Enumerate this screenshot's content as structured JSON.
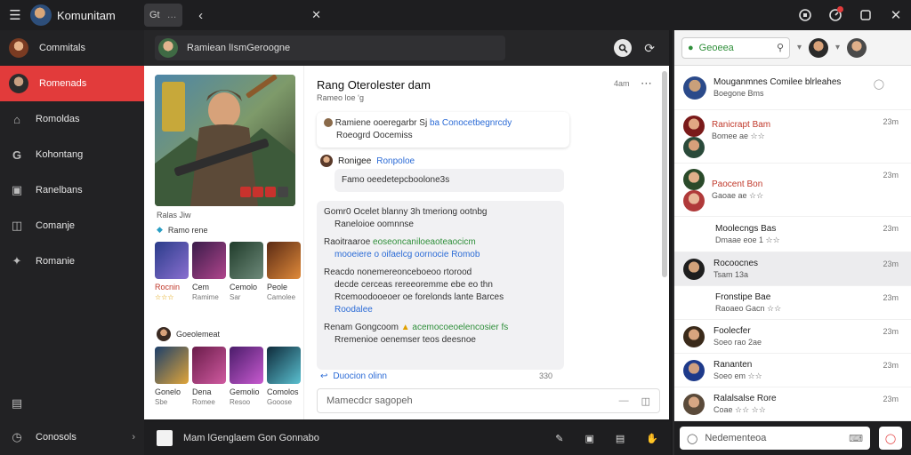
{
  "app": {
    "title": "Komunitam",
    "tab_label": "Gt",
    "tab_badge": "…"
  },
  "sidebar": {
    "items": [
      {
        "label": "Commitals",
        "icon": "avatar-icon"
      },
      {
        "label": "Romenads",
        "icon": "avatar-icon"
      },
      {
        "label": "Romoldas",
        "icon": "home-icon"
      },
      {
        "label": "Kohontang",
        "icon": "g-icon"
      },
      {
        "label": "Ranelbans",
        "icon": "panel-icon"
      },
      {
        "label": "Comanje",
        "icon": "window-icon"
      },
      {
        "label": "Romanie",
        "icon": "star-icon"
      }
    ],
    "bottom": {
      "label": "Conosols",
      "icon": "clock-icon"
    }
  },
  "header": {
    "search_text": "Ramiean lIsmGeroogne"
  },
  "gallery": {
    "hero_title": "Rang Oterolester dam",
    "hero_sub": "Rameo loe ‘g",
    "caption": "Ralas Jiw",
    "tag": "Ramo rene",
    "row1": [
      {
        "name": "Rocnin",
        "sub": "☆☆☆"
      },
      {
        "name": "Cem",
        "sub": "Ramime"
      },
      {
        "name": "Cemolo",
        "sub": "Sar"
      },
      {
        "name": "Peole",
        "sub": "Camolee"
      }
    ],
    "section2": "Goeolemeat",
    "row2": [
      {
        "name": "Gonelo",
        "sub": "Sbe"
      },
      {
        "name": "Dena",
        "sub": "Romee"
      },
      {
        "name": "Gemolio",
        "sub": "Resoo"
      },
      {
        "name": "Comolos",
        "sub": "Gooose"
      }
    ]
  },
  "chat": {
    "title": "Rang Oterolester dam",
    "time": "4am",
    "sub": "Rameo loe ‘g",
    "m1_line1": "Ramiene ooeregarbr Sj",
    "m1_link": "ba Conocetbegnrcdy",
    "m1_line2": "Roeogrd Oocemiss",
    "m2_name": "Ronigee",
    "m2_link": "Ronpoloe",
    "m2_text": "Famo oeedetepcboolone3s",
    "m3_line1": "Gomr0 Ocelet blanny  3h tmeriong ootnbg",
    "m3_line2": "Raneloioe oomnnse",
    "m4_line1": "Raoitraaroe",
    "m4_link": "eoseoncaniloeaoteaocicm",
    "m4_line2a": "mooeiere o",
    "m4_line2b": "oifaelcg oornocie Romob",
    "m5_line1": "Reacdo nonemereonceboeoo rtorood",
    "m5_line2": "decde cerceas rereeoremme ebe eo thn",
    "m5_line3": "Rcemoodooeoer oe forelonds lante Barces",
    "m5_link": "Roodalee",
    "m6_name": "Renam Gongcoom",
    "m6_link": "acemocoeoelencosier fs",
    "m6_line2": "Rremenioe oenemser teos deesnoe",
    "m7_link": "Duocion olinn",
    "m7_meta": "330",
    "composer_placeholder": "Mamecdcr sagopeh"
  },
  "bottombar": {
    "label": "Mam lGenglaem Gon Gonnabo"
  },
  "right": {
    "search": "Geoeea",
    "conversations": [
      {
        "name": "Mouganmnes Comilee blrleahes",
        "sub": "Boegone Bms",
        "time": ""
      },
      {
        "name": "Ranicrapt Bam",
        "sub": "Bomee ae ☆☆",
        "time": "23m",
        "red": true
      },
      {
        "name": "Paocent Bon",
        "sub": "Gaoae ae ☆☆",
        "time": "23m",
        "red": true
      },
      {
        "name": "Moolecngs Bas",
        "sub": "Dmaae eoe 1 ☆☆",
        "time": "23m"
      },
      {
        "name": "Rocoocnes",
        "sub": "Tsam 13a",
        "time": "23m"
      },
      {
        "name": "Fronstipe Bae",
        "sub": "Raoaeo Gacn ☆☆",
        "time": "23m"
      },
      {
        "name": "Foolecfer",
        "sub": "Soeo rao 2ae",
        "time": "23m"
      },
      {
        "name": "Rananten",
        "sub": "Soeo em ☆☆",
        "time": "23m"
      },
      {
        "name": "Ralalsalse Rore",
        "sub": "Coae ☆☆ ☆☆",
        "time": "23m"
      }
    ],
    "input_placeholder": "Nedementeoa"
  },
  "colors": {
    "accent": "#e23b3b",
    "link": "#2b6bd6",
    "green": "#2f8f3a"
  }
}
